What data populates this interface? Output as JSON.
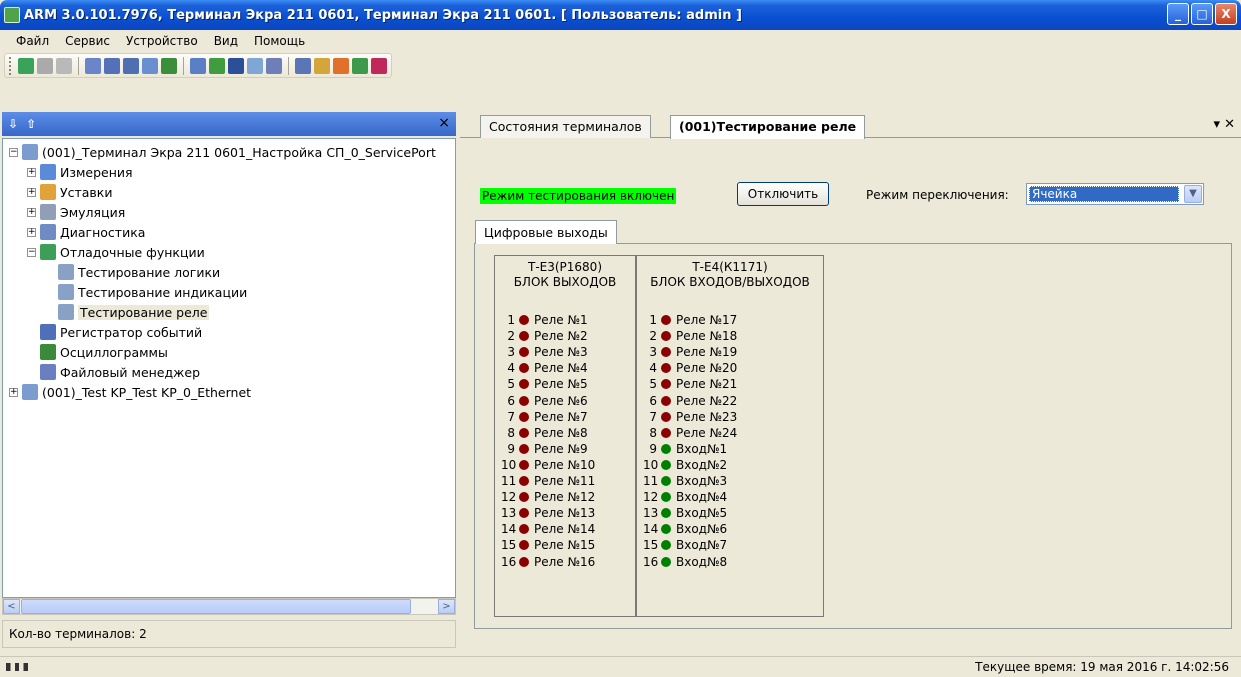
{
  "window": {
    "title": "ARM 3.0.101.7976, Терминал Экра 211 0601, Терминал Экра 211 0601. [ Пользователь: admin ]",
    "btn_min": "_",
    "btn_max": "□",
    "btn_close": "X"
  },
  "menu": [
    "Файл",
    "Сервис",
    "Устройство",
    "Вид",
    "Помощь"
  ],
  "toolbar_icons": [
    {
      "name": "connect-icon",
      "color": "#3aa35a"
    },
    {
      "name": "disconnect-icon",
      "color": "#aaaaaa"
    },
    {
      "name": "properties-icon",
      "color": "#b9b9b9"
    },
    {
      "name": "list-icon",
      "color": "#6b86c8"
    },
    {
      "name": "select-icon",
      "color": "#5470b8"
    },
    {
      "name": "link-icon",
      "color": "#4f6fb0"
    },
    {
      "name": "window-icon",
      "color": "#6a8fd0"
    },
    {
      "name": "export-icon",
      "color": "#3b8e3b"
    },
    {
      "name": "report-icon",
      "color": "#5a7fc6"
    },
    {
      "name": "tree-icon",
      "color": "#3f9d3f"
    },
    {
      "name": "filter-icon",
      "color": "#2b4f99"
    },
    {
      "name": "eye-icon",
      "color": "#7fa7d6"
    },
    {
      "name": "mail-icon",
      "color": "#6e7fb8"
    },
    {
      "name": "chart-icon",
      "color": "#5b76b6"
    },
    {
      "name": "folder-icon",
      "color": "#d4a53a"
    },
    {
      "name": "rss-icon",
      "color": "#e0702a"
    },
    {
      "name": "module-icon",
      "color": "#3c9a4a"
    },
    {
      "name": "book-icon",
      "color": "#c0285c"
    }
  ],
  "left_panel": {
    "close": "×",
    "tree": [
      {
        "label": "(001)_Терминал Экра 211 0601_Настройка СП_0_ServicePort",
        "level": 0,
        "exp": "−",
        "icon": "terminal-icon",
        "color": "#7a9ccf"
      },
      {
        "label": "Измерения",
        "level": 1,
        "exp": "+",
        "icon": "measurements-icon",
        "color": "#5a8ad8"
      },
      {
        "label": "Уставки",
        "level": 1,
        "exp": "+",
        "icon": "settings-folder-icon",
        "color": "#e2a23a"
      },
      {
        "label": "Эмуляция",
        "level": 1,
        "exp": "+",
        "icon": "emulation-icon",
        "color": "#8f9fb6"
      },
      {
        "label": "Диагностика",
        "level": 1,
        "exp": "+",
        "icon": "diagnostics-icon",
        "color": "#6f8bc4"
      },
      {
        "label": "Отладочные функции",
        "level": 1,
        "exp": "−",
        "icon": "debug-icon",
        "color": "#3d9e58"
      },
      {
        "label": "Тестирование логики",
        "level": 2,
        "exp": "",
        "icon": "test-logic-icon",
        "color": "#8aa1c6"
      },
      {
        "label": "Тестирование индикации",
        "level": 2,
        "exp": "",
        "icon": "test-indication-icon",
        "color": "#8aa1c6"
      },
      {
        "label": "Тестирование реле",
        "level": 2,
        "exp": "",
        "icon": "test-relay-icon",
        "color": "#8aa1c6",
        "selected": true
      },
      {
        "label": "Регистратор событий",
        "level": 1,
        "exp": "",
        "icon": "event-recorder-icon",
        "color": "#4f6fb8"
      },
      {
        "label": "Осциллограммы",
        "level": 1,
        "exp": "",
        "icon": "oscillogram-icon",
        "color": "#3b8a3b"
      },
      {
        "label": "Файловый менеджер",
        "level": 1,
        "exp": "",
        "icon": "file-manager-icon",
        "color": "#6a7fc0"
      },
      {
        "label": "(001)_Test KP_Test KP_0_Ethernet",
        "level": 0,
        "exp": "+",
        "icon": "terminal-icon",
        "color": "#7a9ccf"
      }
    ],
    "scroll_left": "<",
    "scroll_right": ">",
    "status": "Кол-во терминалов: 2"
  },
  "tabs": {
    "items": [
      "Состояния терминалов",
      "(001)Тестирование реле"
    ],
    "controls": "▾ ✕"
  },
  "relay_test": {
    "mode_label": "Режим тестирования включен",
    "disable_button": "Отключить",
    "switch_label": "Режим переключения:",
    "switch_value": "Ячейка",
    "subtab": "Цифровые выходы",
    "colors": {
      "relay": "#8b0000",
      "input": "#008000",
      "mode_bg": "#00ff00"
    },
    "blocks": [
      {
        "title1": "Т-Е3(Р1680)",
        "title2": "БЛОК ВЫХОДОВ",
        "rows": [
          {
            "num": "1",
            "label": "Реле №1",
            "type": "relay"
          },
          {
            "num": "2",
            "label": "Реле №2",
            "type": "relay"
          },
          {
            "num": "3",
            "label": "Реле №3",
            "type": "relay"
          },
          {
            "num": "4",
            "label": "Реле №4",
            "type": "relay"
          },
          {
            "num": "5",
            "label": "Реле №5",
            "type": "relay"
          },
          {
            "num": "6",
            "label": "Реле №6",
            "type": "relay"
          },
          {
            "num": "7",
            "label": "Реле №7",
            "type": "relay"
          },
          {
            "num": "8",
            "label": "Реле №8",
            "type": "relay"
          },
          {
            "num": "9",
            "label": "Реле №9",
            "type": "relay"
          },
          {
            "num": "10",
            "label": "Реле №10",
            "type": "relay"
          },
          {
            "num": "11",
            "label": "Реле №11",
            "type": "relay"
          },
          {
            "num": "12",
            "label": "Реле №12",
            "type": "relay"
          },
          {
            "num": "13",
            "label": "Реле №13",
            "type": "relay"
          },
          {
            "num": "14",
            "label": "Реле №14",
            "type": "relay"
          },
          {
            "num": "15",
            "label": "Реле №15",
            "type": "relay"
          },
          {
            "num": "16",
            "label": "Реле №16",
            "type": "relay"
          }
        ]
      },
      {
        "title1": "Т-Е4(К1171)",
        "title2": "БЛОК ВХОДОВ/ВЫХОДОВ",
        "rows": [
          {
            "num": "1",
            "label": "Реле №17",
            "type": "relay"
          },
          {
            "num": "2",
            "label": "Реле №18",
            "type": "relay"
          },
          {
            "num": "3",
            "label": "Реле №19",
            "type": "relay"
          },
          {
            "num": "4",
            "label": "Реле №20",
            "type": "relay"
          },
          {
            "num": "5",
            "label": "Реле №21",
            "type": "relay"
          },
          {
            "num": "6",
            "label": "Реле №22",
            "type": "relay"
          },
          {
            "num": "7",
            "label": "Реле №23",
            "type": "relay"
          },
          {
            "num": "8",
            "label": "Реле №24",
            "type": "relay"
          },
          {
            "num": "9",
            "label": "Вход№1",
            "type": "input"
          },
          {
            "num": "10",
            "label": "Вход№2",
            "type": "input"
          },
          {
            "num": "11",
            "label": "Вход№3",
            "type": "input"
          },
          {
            "num": "12",
            "label": "Вход№4",
            "type": "input"
          },
          {
            "num": "13",
            "label": "Вход№5",
            "type": "input"
          },
          {
            "num": "14",
            "label": "Вход№6",
            "type": "input"
          },
          {
            "num": "15",
            "label": "Вход№7",
            "type": "input"
          },
          {
            "num": "16",
            "label": "Вход№8",
            "type": "input"
          }
        ]
      }
    ]
  },
  "statusbar": {
    "time": "Текущее время: 19 мая 2016 г. 14:02:56"
  }
}
